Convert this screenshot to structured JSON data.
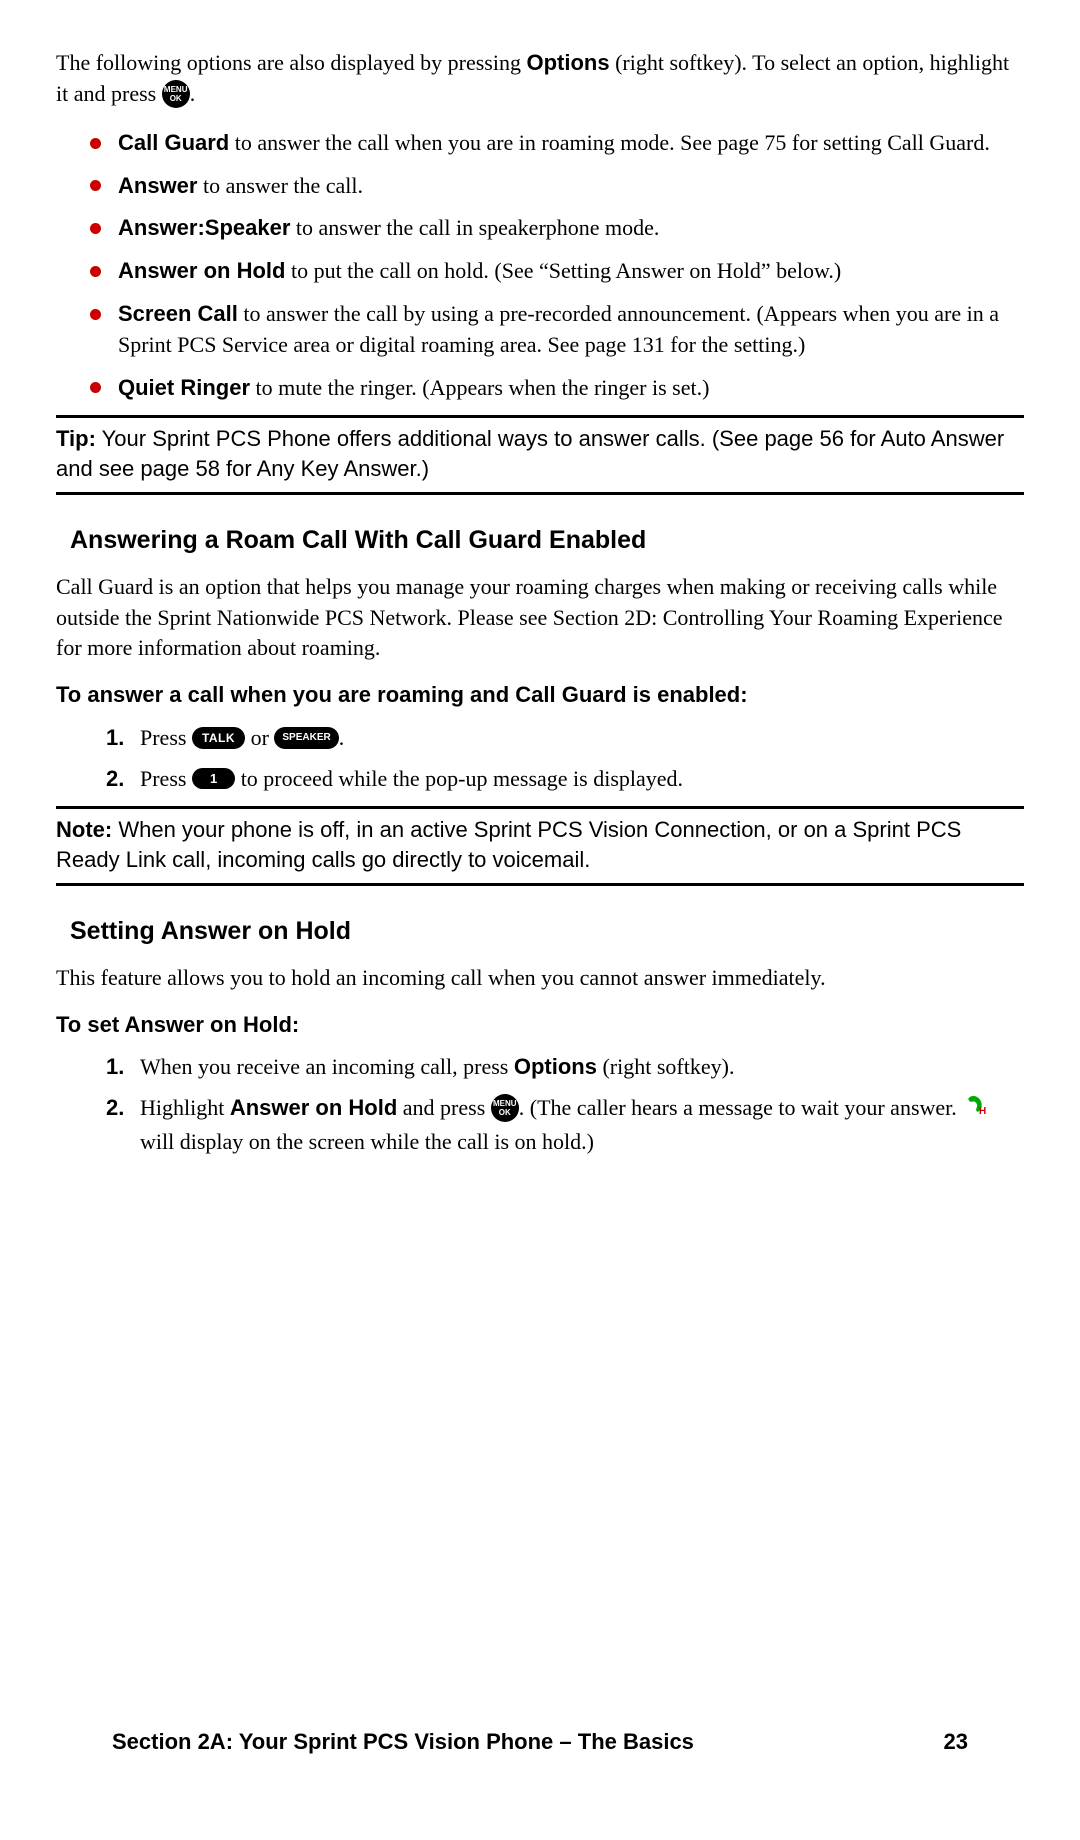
{
  "intro": {
    "t1": "The following options are also displayed by pressing ",
    "options": "Options",
    "t2": " (right softkey). To select an option, highlight it and press ",
    "menu": "MENU",
    "ok": "OK",
    "t3": "."
  },
  "bullets": [
    {
      "b": "Call Guard",
      "t": " to answer the call when you are in roaming mode. See page 75 for setting Call Guard."
    },
    {
      "b": "Answer",
      "t": " to answer the call."
    },
    {
      "b": "Answer:Speaker",
      "t": " to answer the call in speakerphone mode."
    },
    {
      "b": "Answer on Hold",
      "t": " to put the call on hold. (See “Setting Answer on Hold” below.)"
    },
    {
      "b": "Screen Call",
      "t": " to answer the call by using a pre-recorded announcement. (Appears when you are in a Sprint PCS Service area or digital roaming area. See page 131 for the setting.)"
    },
    {
      "b": "Quiet Ringer",
      "t": " to mute the ringer. (Appears when the ringer is set.)"
    }
  ],
  "tip": {
    "label": "Tip:",
    "text": " Your Sprint PCS Phone offers additional ways to answer calls. (See page 56 for Auto Answer and see page 58 for Any Key Answer.)"
  },
  "section1": {
    "heading": "Answering a Roam Call With Call Guard Enabled",
    "para": "Call Guard is an option that helps you manage your roaming charges when making or receiving calls while outside the Sprint Nationwide PCS Network. Please see Section 2D: Controlling Your Roaming Experience for more information about roaming.",
    "instr_head": "To answer a call when you are roaming and Call Guard is enabled:",
    "step1_a": "Press ",
    "talk": "TALK",
    "step1_b": " or ",
    "speaker": "SPEAKER",
    "step1_c": ".",
    "step2_a": "Press ",
    "one": "1",
    "step2_b": " to proceed while the pop-up message is displayed."
  },
  "note": {
    "label": "Note:",
    "text": " When your phone is off, in an active Sprint PCS Vision Connection, or on a Sprint PCS Ready Link call, incoming calls go directly to voicemail."
  },
  "section2": {
    "heading": "Setting Answer on Hold",
    "para": "This feature allows you to hold an incoming call when you cannot answer immediately.",
    "instr_head": "To set Answer on Hold:",
    "step1_a": "When you receive an incoming call, press ",
    "options": "Options",
    "step1_b": " (right softkey).",
    "step2_a": "Highlight ",
    "aoh": "Answer on Hold",
    "step2_b": " and press ",
    "menu": "MENU",
    "ok": "OK",
    "step2_c": ". (The caller hears a message to wait your answer. ",
    "h": "H",
    "step2_d": " will display on the screen while the call is on hold.)"
  },
  "footer": {
    "section": "Section 2A: Your Sprint PCS Vision Phone – The Basics",
    "page": "23"
  }
}
